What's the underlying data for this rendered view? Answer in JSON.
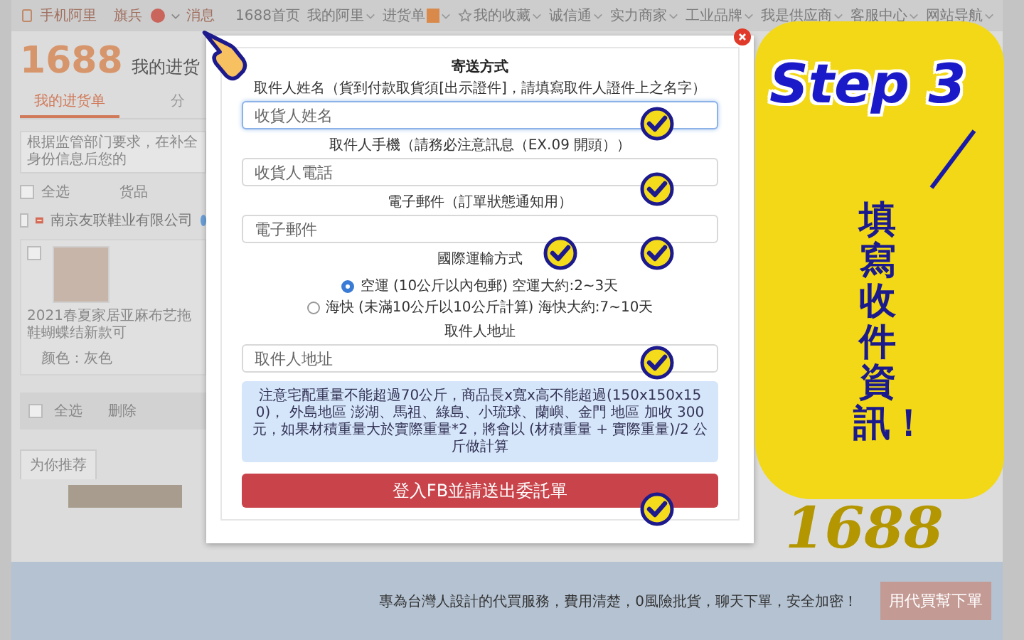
{
  "top_bar": {
    "left": [
      {
        "label": "手机阿里",
        "kind": "phone"
      },
      {
        "label": "旗兵",
        "kind": "user"
      },
      {
        "label": "消息",
        "kind": "plain"
      }
    ],
    "right": [
      {
        "label": "1688首页",
        "kind": "plain"
      },
      {
        "label": "我的阿里",
        "kind": "menu"
      },
      {
        "label": "进货单",
        "kind": "cart"
      },
      {
        "label": "我的收藏",
        "kind": "fav"
      },
      {
        "label": "诚信通",
        "kind": "menu"
      },
      {
        "label": "实力商家",
        "kind": "menu"
      },
      {
        "label": "工业品牌",
        "kind": "menu"
      },
      {
        "label": "我是供应商",
        "kind": "menu"
      },
      {
        "label": "客服中心",
        "kind": "menu"
      },
      {
        "label": "网站导航",
        "kind": "menu"
      }
    ]
  },
  "page": {
    "logo": "1688",
    "title": "我的进货",
    "tabs": [
      {
        "label": "我的进货单",
        "selected": true
      },
      {
        "label": "分",
        "selected": false
      }
    ],
    "notice": "根据监管部门要求，在补全身份信息后您的",
    "select_all": {
      "label": "全选",
      "checked": false
    },
    "goods_header": "货品",
    "shop": {
      "name": "南京友联鞋业有限公司",
      "checked": false
    },
    "product": {
      "title": "2021春夏家居亚麻布艺拖鞋蝴蝶结新款可",
      "attribute": "颜色：灰色",
      "checked": false
    },
    "footer": {
      "select_all": "全选",
      "checked": false,
      "delete": "删除"
    },
    "recommend_tab": "为你推荐"
  },
  "modal": {
    "title": "寄送方式",
    "fields": [
      {
        "kind": "input",
        "label": "取件人姓名（貨到付款取貨須[出示證件]，請填寫取件人證件上之名字）",
        "placeholder": "收貨人姓名",
        "focused": true
      },
      {
        "kind": "input",
        "label": "取件人手機（請務必注意訊息（EX.09 開頭））",
        "placeholder": "收貨人電話",
        "focused": false
      },
      {
        "kind": "input",
        "label": "電子郵件（訂單狀態通知用）",
        "placeholder": "電子郵件",
        "focused": false
      },
      {
        "kind": "radio",
        "label": "國際運輸方式",
        "options": [
          {
            "label": "空運 (10公斤以內包郵) 空運大約:2~3天",
            "selected": true
          },
          {
            "label": "海快 (未滿10公斤以10公斤計算) 海快大約:7~10天",
            "selected": false
          }
        ]
      },
      {
        "kind": "input",
        "label": "取件人地址",
        "placeholder": "取件人地址",
        "focused": false
      }
    ],
    "notice": "注意宅配重量不能超過70公斤，商品長x寬x高不能超過(150x150x150)， 外島地區 澎湖、馬祖、綠島、小琉球、蘭嶼、金門 地區 加收 300元，如果材積重量大於實際重量*2，將會以 (材積重量 + 實際重量)/2 公斤做計算",
    "submit": "登入FB並請送出委託單"
  },
  "tutorial": {
    "step": "Step 3",
    "caption": "填寫收件資訊！",
    "logo": "1688"
  },
  "bottom_bar": {
    "text": "專為台灣人設計的代買服務，費用清楚，0風險批貨，聊天下單，安全加密！",
    "button": "用代買幫下單"
  }
}
